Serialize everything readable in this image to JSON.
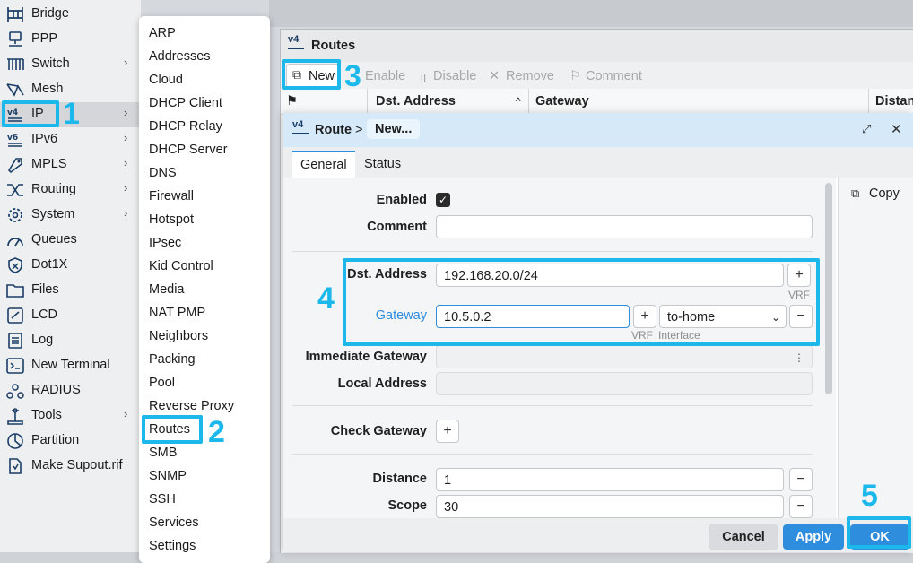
{
  "sidebar": {
    "items": [
      {
        "label": "Bridge",
        "icon": "bridge-icon",
        "has_submenu": false
      },
      {
        "label": "PPP",
        "icon": "ppp-icon",
        "has_submenu": false
      },
      {
        "label": "Switch",
        "icon": "switch-icon",
        "has_submenu": true
      },
      {
        "label": "Mesh",
        "icon": "mesh-icon",
        "has_submenu": false
      },
      {
        "label": "IP",
        "icon": "ipv4-icon",
        "has_submenu": true
      },
      {
        "label": "IPv6",
        "icon": "ipv6-icon",
        "has_submenu": true
      },
      {
        "label": "MPLS",
        "icon": "mpls-icon",
        "has_submenu": true
      },
      {
        "label": "Routing",
        "icon": "routing-icon",
        "has_submenu": true
      },
      {
        "label": "System",
        "icon": "gear-icon",
        "has_submenu": true
      },
      {
        "label": "Queues",
        "icon": "queues-icon",
        "has_submenu": false
      },
      {
        "label": "Dot1X",
        "icon": "dot1x-icon",
        "has_submenu": false
      },
      {
        "label": "Files",
        "icon": "folder-icon",
        "has_submenu": false
      },
      {
        "label": "LCD",
        "icon": "lcd-icon",
        "has_submenu": false
      },
      {
        "label": "Log",
        "icon": "log-icon",
        "has_submenu": false
      },
      {
        "label": "New Terminal",
        "icon": "terminal-icon",
        "has_submenu": false
      },
      {
        "label": "RADIUS",
        "icon": "radius-icon",
        "has_submenu": false
      },
      {
        "label": "Tools",
        "icon": "tools-icon",
        "has_submenu": true
      },
      {
        "label": "Partition",
        "icon": "partition-icon",
        "has_submenu": false
      },
      {
        "label": "Make Supout.rif",
        "icon": "supout-icon",
        "has_submenu": false
      }
    ]
  },
  "ip_menu": {
    "items": [
      "ARP",
      "Addresses",
      "Cloud",
      "DHCP Client",
      "DHCP Relay",
      "DHCP Server",
      "DNS",
      "Firewall",
      "Hotspot",
      "IPsec",
      "Kid Control",
      "Media",
      "NAT PMP",
      "Neighbors",
      "Packing",
      "Pool",
      "Reverse Proxy",
      "Routes",
      "SMB",
      "SNMP",
      "SSH",
      "Services",
      "Settings"
    ]
  },
  "routes_window": {
    "title": "Routes",
    "icon_text": "v4",
    "toolbar": {
      "new": "New",
      "enable": "Enable",
      "disable": "Disable",
      "remove": "Remove",
      "comment": "Comment"
    },
    "columns": {
      "dst_address": "Dst. Address",
      "gateway": "Gateway",
      "distance": "Distanc"
    }
  },
  "route_dialog": {
    "breadcrumb_root": "Route",
    "breadcrumb_sep": ">",
    "breadcrumb_current": "New...",
    "tabs": [
      "General",
      "Status"
    ],
    "side_copy": "Copy",
    "fields": {
      "enabled_label": "Enabled",
      "enabled_checked": true,
      "comment_label": "Comment",
      "comment_value": "",
      "dst_label": "Dst. Address",
      "dst_value": "192.168.20.0/24",
      "dst_hint": "VRF",
      "gateway_label": "Gateway",
      "gateway_value": "10.5.0.2",
      "gateway_hint_vrf": "VRF",
      "gateway_hint_iface": "Interface",
      "interface_value": "to-home",
      "immediate_gateway_label": "Immediate Gateway",
      "local_address_label": "Local Address",
      "check_gateway_label": "Check Gateway",
      "distance_label": "Distance",
      "distance_value": "1",
      "scope_label": "Scope",
      "scope_value": "30"
    },
    "footer": {
      "cancel": "Cancel",
      "apply": "Apply",
      "ok": "OK"
    }
  },
  "callouts": {
    "n1": "1",
    "n2": "2",
    "n3": "3",
    "n4": "4",
    "n5": "5"
  },
  "colors": {
    "highlight": "#1cb8ec",
    "apply_blue": "#2f8dde",
    "title_blue": "#d5e9f9"
  }
}
